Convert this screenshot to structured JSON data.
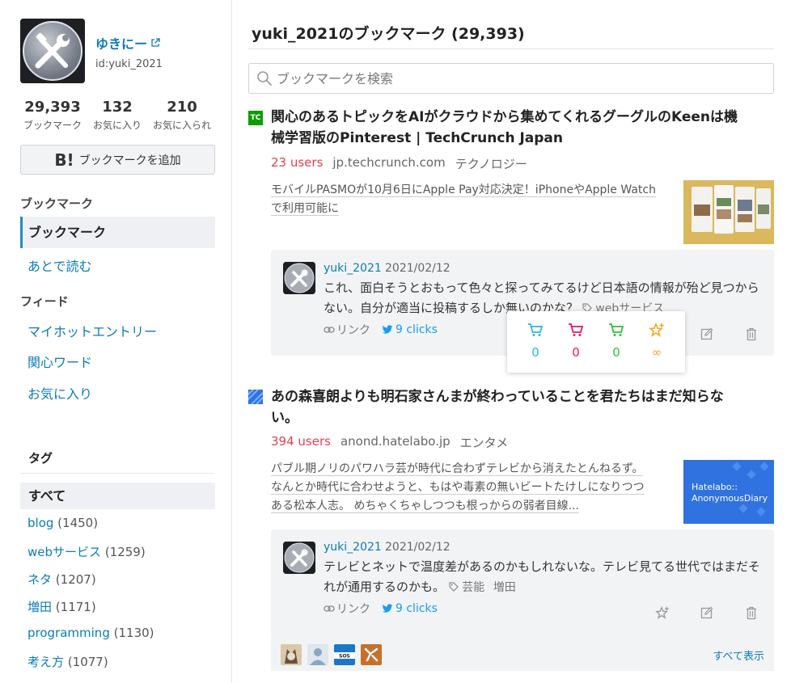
{
  "profile": {
    "display_name": "ゆきにー",
    "user_id": "id:yuki_2021",
    "stats": [
      {
        "value": "29,393",
        "label": "ブックマーク"
      },
      {
        "value": "132",
        "label": "お気に入り"
      },
      {
        "value": "210",
        "label": "お気に入られ"
      }
    ],
    "add_bookmark_mark": "B!",
    "add_bookmark_label": "ブックマークを追加"
  },
  "sidebar": {
    "section_bookmarks": "ブックマーク",
    "active_item": "ブックマーク",
    "read_later": "あとで読む",
    "section_feed": "フィード",
    "feed_items": [
      "マイホットエントリー",
      "関心ワード",
      "お気に入り"
    ],
    "tags_heading": "タグ",
    "tags_all": "すべて",
    "tags": [
      {
        "name": "blog",
        "count": "(1450)"
      },
      {
        "name": "webサービス",
        "count": "(1259)"
      },
      {
        "name": "ネタ",
        "count": "(1207)"
      },
      {
        "name": "増田",
        "count": "(1171)"
      },
      {
        "name": "programming",
        "count": "(1130)"
      },
      {
        "name": "考え方",
        "count": "(1077)"
      }
    ]
  },
  "main": {
    "page_title": "yuki_2021のブックマーク (29,393)",
    "search_placeholder": "ブックマークを検索",
    "entries": [
      {
        "title_line1": "関心のあるトピックをAIがクラウドから集めてくれるグーグルのKeenは機",
        "title_line2": "械学習版のPinterest | TechCrunch Japan",
        "users": "23 users",
        "domain": "jp.techcrunch.com",
        "category": "テクノロジー",
        "desc_line1": "モバイルPASMOが10月6日にApple Pay対応決定！iPhoneやApple Watch",
        "desc_line2": "で利用可能に",
        "favicon": "TC",
        "comment": {
          "user": "yuki_2021",
          "date": "2021/02/12",
          "text_line1": "これ、面白そうとおもって色々と探ってみてるけど日本語の情報が殆ど見つから",
          "text_line2": "ない。自分が適当に投稿するしか無いのかな？",
          "tags": [
            "webサービス"
          ],
          "link_label": "リンク",
          "clicks": "9 clicks"
        }
      },
      {
        "title_line1": "あの森喜朗よりも明石家さんまが終わっていることを君たちはまだ知らな",
        "title_line2": "い。",
        "users": "394 users",
        "domain": "anond.hatelabo.jp",
        "category": "エンタメ",
        "desc_line1": "パブル期ノリのパワハラ芸が時代に合わずテレビから消えたとんねるず。",
        "desc_line2": "なんとか時代に合わせようと、もはや毒素の無いビートたけしになりつつ",
        "desc_line3": "ある松本人志。 めちゃくちゃしつつも根っからの弱者目線...",
        "thumb_line1": "Hatelabo::",
        "thumb_line2": "AnonymousDiary",
        "comment": {
          "user": "yuki_2021",
          "date": "2021/02/12",
          "text_line1": "テレビとネットで温度差があるのかもしれないな。テレビ見てる世代ではまだそ",
          "text_line2": "れが通用するのかも。",
          "tags": [
            "芸能",
            "増田"
          ],
          "link_label": "リンク",
          "clicks": "9 clicks"
        },
        "show_all": "すべて表示"
      }
    ],
    "star_popup": [
      {
        "color": "#29b6e8",
        "count": "0"
      },
      {
        "color": "#e8185f",
        "count": "0"
      },
      {
        "color": "#2fbf2f",
        "count": "0"
      },
      {
        "color": "#f5a623",
        "count": "∞"
      }
    ]
  },
  "colors": {
    "link": "#0a7cb5",
    "users": "#e5414f",
    "twitter": "#1d9bf0",
    "comment_bg": "#f2f3f5"
  }
}
